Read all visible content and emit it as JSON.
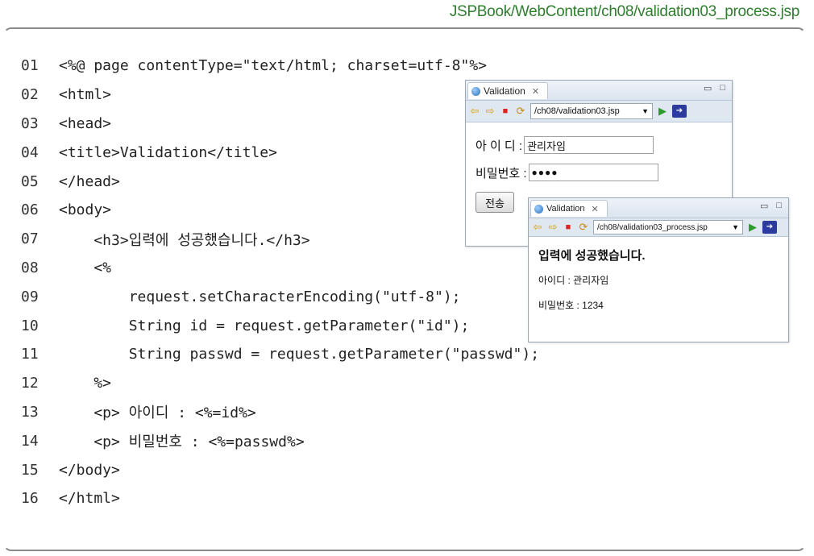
{
  "file_path": "JSPBook/WebContent/ch08/validation03_process.jsp",
  "code_lines": [
    {
      "no": "01",
      "text": "<%@ page contentType=\"text/html; charset=utf-8\"%>"
    },
    {
      "no": "02",
      "text": "<html>"
    },
    {
      "no": "03",
      "text": "<head>"
    },
    {
      "no": "04",
      "text": "<title>Validation</title>"
    },
    {
      "no": "05",
      "text": "</head>"
    },
    {
      "no": "06",
      "text": "<body>"
    },
    {
      "no": "07",
      "text": "    <h3>입력에 성공했습니다.</h3>"
    },
    {
      "no": "08",
      "text": "    <%"
    },
    {
      "no": "09",
      "text": "        request.setCharacterEncoding(\"utf-8\");"
    },
    {
      "no": "10",
      "text": "        String id = request.getParameter(\"id\");"
    },
    {
      "no": "11",
      "text": "        String passwd = request.getParameter(\"passwd\");"
    },
    {
      "no": "12",
      "text": "    %>"
    },
    {
      "no": "13",
      "text": "    <p> 아이디 : <%=id%>"
    },
    {
      "no": "14",
      "text": "    <p> 비밀번호 : <%=passwd%>"
    },
    {
      "no": "15",
      "text": "</body>"
    },
    {
      "no": "16",
      "text": "</html>"
    }
  ],
  "browser1": {
    "tab_title": "Validation",
    "url": "/ch08/validation03.jsp",
    "id_label": "아 이 디 :",
    "id_value": "관리자임",
    "pw_label": "비밀번호 :",
    "pw_value": "●●●●",
    "submit_label": "전송"
  },
  "browser2": {
    "tab_title": "Validation",
    "url": "/ch08/validation03_process.jsp",
    "heading": "입력에 성공했습니다.",
    "id_line": "아이디 : 관리자임",
    "pw_line": "비밀번호 : 1234"
  },
  "icons": {
    "tab_close": "close-icon",
    "minimize": "minimize-icon",
    "maximize": "maximize-icon"
  }
}
